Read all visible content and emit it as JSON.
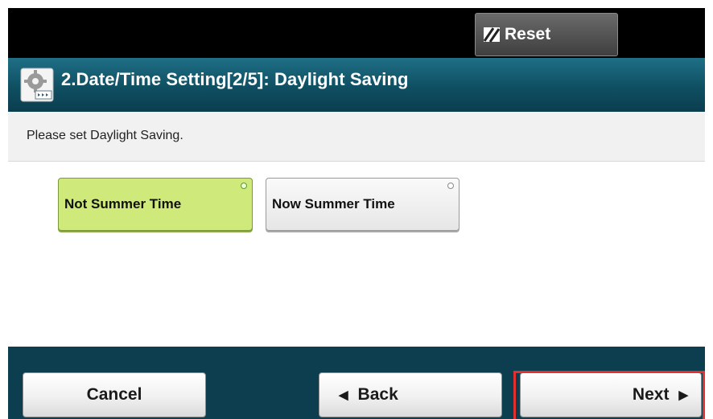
{
  "header": {
    "reset_label": "Reset",
    "reset_icon": "reset-slash-icon"
  },
  "title": {
    "text": "2.Date/Time Setting[2/5]: Daylight Saving",
    "icon": "settings-gear-icon"
  },
  "message": {
    "text": "Please set Daylight Saving."
  },
  "options": [
    {
      "label": "Not Summer Time",
      "selected": true
    },
    {
      "label": "Now Summer Time",
      "selected": false
    }
  ],
  "footer": {
    "cancel_label": "Cancel",
    "back_label": "Back",
    "next_label": "Next",
    "back_icon": "left-arrow-icon",
    "next_icon": "right-arrow-icon"
  },
  "colors": {
    "title_bar": "#0f4f62",
    "footer_bar": "#0c3e4f",
    "selected_option": "#cfe97a",
    "highlight": "#e03030"
  }
}
